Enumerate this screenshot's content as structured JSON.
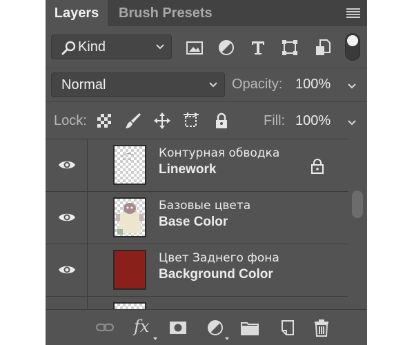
{
  "tabs": [
    {
      "label": "Layers",
      "active": true
    },
    {
      "label": "Brush Presets",
      "active": false
    }
  ],
  "filter": {
    "kind_value": "Kind",
    "icons": [
      "image-filter-icon",
      "adjustment-filter-icon",
      "type-filter-icon",
      "shape-filter-icon",
      "smart-object-filter-icon"
    ]
  },
  "blend": {
    "mode_value": "Normal",
    "opacity_label": "Opacity:",
    "opacity_value": "100%"
  },
  "lock": {
    "label": "Lock:",
    "fill_label": "Fill:",
    "fill_value": "100%"
  },
  "layers": [
    {
      "name_ru": "Контурная обводка",
      "name_en": "Linework",
      "visible": true,
      "locked": true,
      "thumb": "transparent-sketch"
    },
    {
      "name_ru": "Базовые цвета",
      "name_en": "Base Color",
      "visible": true,
      "locked": false,
      "thumb": "character-colors"
    },
    {
      "name_ru": "Цвет Заднего фона",
      "name_en": "Background Color",
      "visible": true,
      "locked": false,
      "thumb": "solid-fill",
      "fill_color": "#8b1f1a"
    }
  ],
  "colors": {
    "panel_bg": "#535353",
    "tabbar_bg": "#424242",
    "background_layer_fill": "#8b1f1a"
  },
  "bottom_icons": [
    "link-layers-icon",
    "fx-icon",
    "add-mask-icon",
    "adjustment-layer-icon",
    "new-group-icon",
    "new-layer-icon",
    "delete-layer-icon"
  ]
}
